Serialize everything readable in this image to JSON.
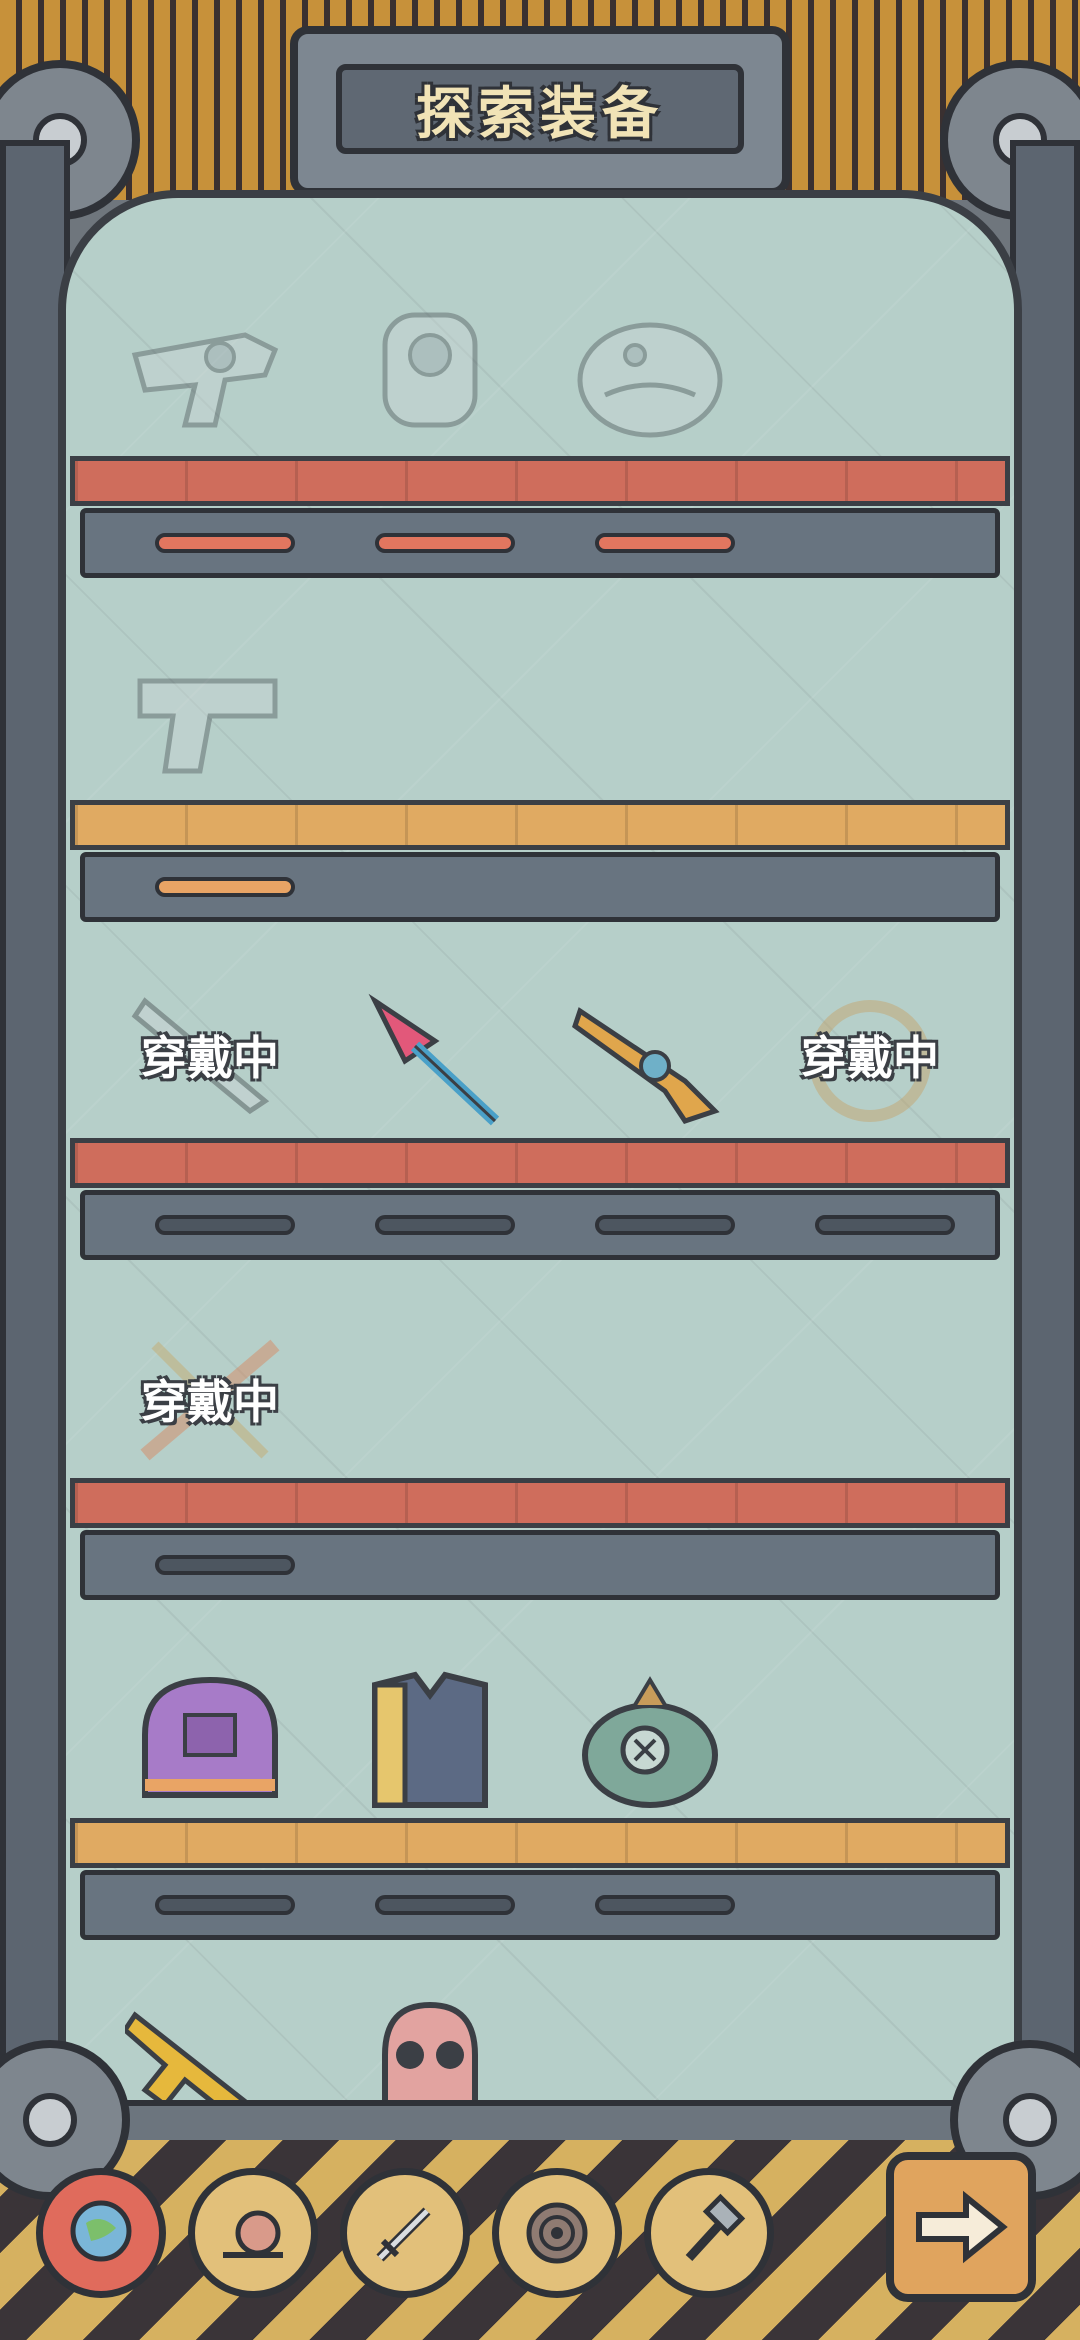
{
  "header": {
    "title": "探索装备"
  },
  "shelves": [
    {
      "plank_color": "#cf6d5c",
      "items": [
        {
          "icon": "blaster-gun-icon",
          "state": "locked"
        },
        {
          "icon": "mech-armor-icon",
          "state": "locked"
        },
        {
          "icon": "creature-helmet-icon",
          "state": "locked"
        }
      ]
    },
    {
      "plank_color": "#e0aa62",
      "items": [
        {
          "icon": "pistol-icon",
          "state": "locked"
        }
      ]
    },
    {
      "plank_color": "#cf6d5c",
      "items": [
        {
          "icon": "blade-icon",
          "state": "equipped",
          "label": "穿戴中"
        },
        {
          "icon": "trident-icon",
          "state": "owned"
        },
        {
          "icon": "ray-gun-icon",
          "state": "owned"
        },
        {
          "icon": "crown-icon",
          "state": "equipped",
          "label": "穿戴中"
        }
      ]
    },
    {
      "plank_color": "#cf6d5c",
      "items": [
        {
          "icon": "flame-sword-icon",
          "state": "equipped",
          "label": "穿戴中"
        }
      ]
    },
    {
      "plank_color": "#e0aa62",
      "items": [
        {
          "icon": "space-helmet-icon",
          "state": "owned"
        },
        {
          "icon": "jacket-icon",
          "state": "owned"
        },
        {
          "icon": "diving-helmet-icon",
          "state": "owned"
        }
      ]
    },
    {
      "plank_color": "#e0aa62",
      "items": [
        {
          "icon": "assault-rifle-icon",
          "state": "owned"
        },
        {
          "icon": "gas-mask-icon",
          "state": "owned"
        }
      ]
    }
  ],
  "tabs": [
    {
      "icon": "globe-icon",
      "active": true
    },
    {
      "icon": "snail-icon",
      "active": false
    },
    {
      "icon": "sword-icon",
      "active": false
    },
    {
      "icon": "spiral-shell-icon",
      "active": false
    },
    {
      "icon": "hammer-icon",
      "active": false
    }
  ],
  "next_button": {
    "icon": "arrow-right-icon"
  }
}
